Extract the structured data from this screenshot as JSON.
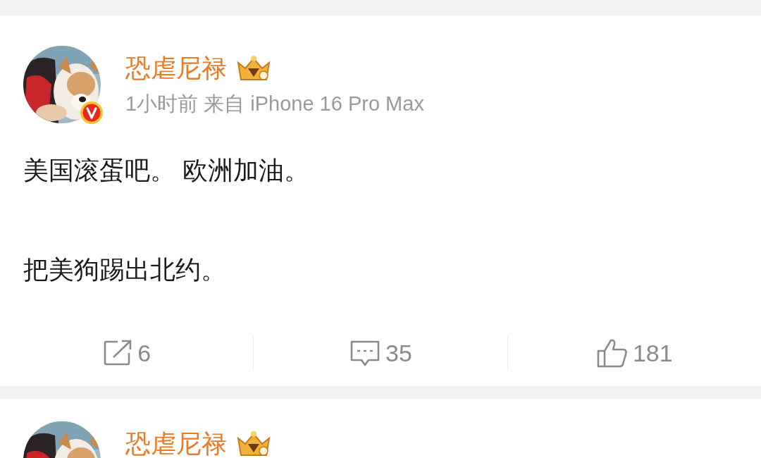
{
  "posts": [
    {
      "author": "恐虐尼禄",
      "verified": true,
      "meta": "1小时前 来自 iPhone 16 Pro Max",
      "paragraphs": [
        "美国滚蛋吧。 欧洲加油。",
        "把美狗踢出北约。"
      ],
      "actions": [
        {
          "kind": "repost",
          "count": "6"
        },
        {
          "kind": "comment",
          "count": "35"
        },
        {
          "kind": "like",
          "count": "181"
        }
      ]
    },
    {
      "author": "恐虐尼禄"
    }
  ]
}
